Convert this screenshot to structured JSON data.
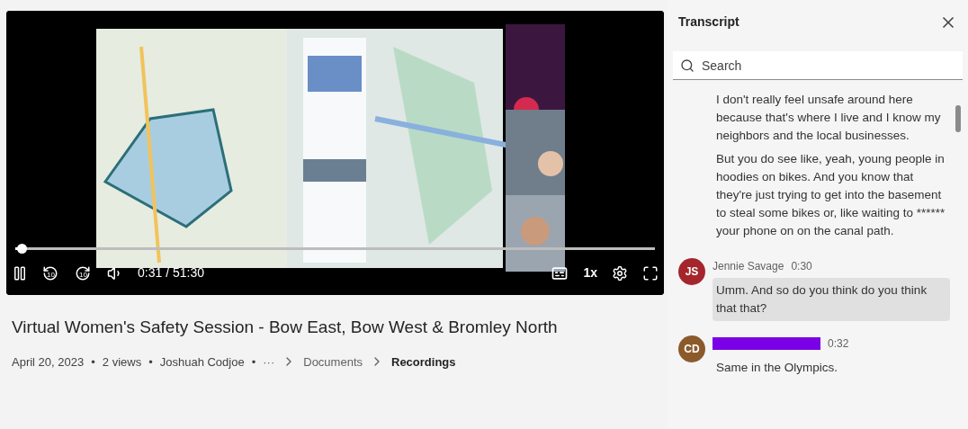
{
  "player": {
    "progress": {
      "level": 0.01
    },
    "time": "0:31 / 51:30",
    "speed": "1x",
    "skip_back": "10",
    "skip_forward": "10",
    "playing": true,
    "captions_on": false
  },
  "video": {
    "title": "Virtual Women's Safety Session - Bow East, Bow West & Bromley North",
    "meta": [
      "April 20, 2023",
      "2 views",
      "Joshuah Codjoe"
    ],
    "separator": "•",
    "breadcrumb": [
      {
        "label": "···",
        "current": false
      },
      {
        "label": "Documents",
        "current": false
      },
      {
        "label": "Recordings",
        "current": true
      }
    ]
  },
  "transcript": {
    "title": "Transcript",
    "search": {
      "placeholder": "Search"
    },
    "entries": [
      {
        "paragraphs": [
          "I don't really feel unsafe around here because that's where I live and I know my neighbors and the local businesses.",
          "But you do see like, yeah, young people in hoodies on bikes. And you know that they're just trying to get into the basement to steal some bikes or, like waiting to ****** your phone on on the canal path."
        ],
        "selected": false
      },
      {
        "initials": "JS",
        "color": "#a4262c",
        "speaker": "Jennie Savage",
        "time": "0:30",
        "paragraphs": [
          "Umm. And so do you think do you think that that?"
        ],
        "selected": true
      },
      {
        "initials": "CD",
        "color": "#8b5a2b",
        "redacted": true,
        "time": "0:32",
        "paragraphs": [
          "Same in the Olympics."
        ],
        "selected": false
      }
    ]
  }
}
